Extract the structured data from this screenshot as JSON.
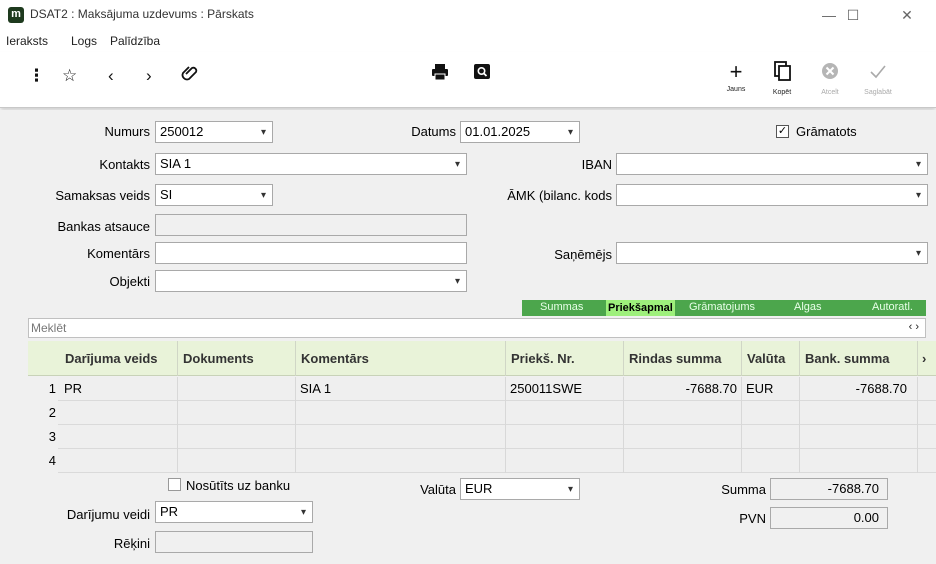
{
  "window": {
    "app_icon": "m",
    "title": "DSAT2 : Maksājuma uzdevums : Pārskats",
    "minimize": "—",
    "maximize": "☐",
    "close": "✕"
  },
  "menu": [
    "Ieraksts",
    "Logs",
    "Palīdzība"
  ],
  "toolbar": {
    "icons": [
      "more-vertical-icon",
      "star-icon",
      "chevron-left-icon",
      "chevron-right-icon",
      "attachment-icon",
      "print-icon",
      "search-preview-icon"
    ],
    "new_label": "Jauns",
    "copy_label": "Kopēt",
    "cancel_label": "Atcelt",
    "save_label": "Saglabāt"
  },
  "form": {
    "numurs_label": "Numurs",
    "numurs_value": "250012",
    "datums_label": "Datums",
    "datums_value": "01.01.2025",
    "gramatots_label": "Grāmatots",
    "gramatots_checked": true,
    "kontakts_label": "Kontakts",
    "kontakts_value": "SIA 1",
    "iban_label": "IBAN",
    "iban_value": "",
    "samaksas_label": "Samaksas veids",
    "samaksas_value": "SI",
    "amk_label": "ĀMK (bilanc. kods",
    "amk_value": "",
    "bankas_label": "Bankas atsauce",
    "bankas_value": "",
    "komentars_label": "Komentārs",
    "komentars_value": "",
    "sanemejs_label": "Saņēmējs",
    "sanemejs_value": "",
    "objekti_label": "Objekti",
    "objekti_value": ""
  },
  "tabs": [
    "Summas",
    "Priekšapmal",
    "Grāmatojums",
    "Algas",
    "Autoratl."
  ],
  "active_tab": "Priekšapmal",
  "search": {
    "placeholder": "Meklēt",
    "nav": "‹  ›"
  },
  "grid": {
    "columns": [
      "Darījuma veids",
      "Dokuments",
      "Komentārs",
      "Priekš. Nr.",
      "Rindas summa",
      "Valūta",
      "Bank. summa"
    ],
    "more": "›",
    "rows": [
      {
        "n": "1",
        "veids": "PR",
        "dok": "",
        "kom": "SIA 1",
        "nr": "250011SWE",
        "summa": "-7688.70",
        "valuta": "EUR",
        "bank": "-7688.70"
      },
      {
        "n": "2",
        "veids": "",
        "dok": "",
        "kom": "",
        "nr": "",
        "summa": "",
        "valuta": "",
        "bank": ""
      },
      {
        "n": "3",
        "veids": "",
        "dok": "",
        "kom": "",
        "nr": "",
        "summa": "",
        "valuta": "",
        "bank": ""
      },
      {
        "n": "4",
        "veids": "",
        "dok": "",
        "kom": "",
        "nr": "",
        "summa": "",
        "valuta": "",
        "bank": ""
      }
    ]
  },
  "bottom": {
    "nosutits_label": "Nosūtīts uz banku",
    "nosutits_checked": false,
    "valuta_label": "Valūta",
    "valuta_value": "EUR",
    "summa_label": "Summa",
    "summa_value": "-7688.70",
    "veidi_label": "Darījumu veidi",
    "veidi_value": "PR",
    "pvn_label": "PVN",
    "pvn_value": "0.00",
    "rekini_label": "Rēķini",
    "rekini_value": ""
  }
}
